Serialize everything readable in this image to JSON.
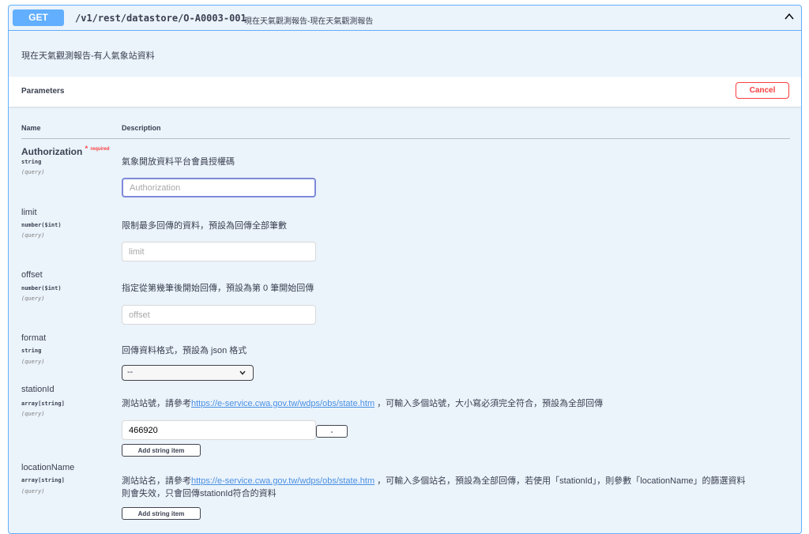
{
  "summary": {
    "method": "GET",
    "path": "/v1/rest/datastore/O-A0003-001",
    "description": "現在天氣觀測報告-現在天氣觀測報告",
    "toggle_icon": "chevron-up-icon"
  },
  "description": "現在天氣觀測報告-有人氣象站資料",
  "parameters_section": {
    "title": "Parameters",
    "cancel_label": "Cancel",
    "col_name": "Name",
    "col_description": "Description"
  },
  "params": {
    "authorization": {
      "name": "Authorization",
      "required_star": "*",
      "required_label": "required",
      "type": "string",
      "in": "(query)",
      "description": "氣象開放資料平台會員授權碼",
      "placeholder": "Authorization"
    },
    "limit": {
      "name": "limit",
      "type": "number($int)",
      "in": "(query)",
      "description": "限制最多回傳的資料，預設為回傳全部筆數",
      "placeholder": "limit"
    },
    "offset": {
      "name": "offset",
      "type": "number($int)",
      "in": "(query)",
      "description": "指定從第幾筆後開始回傳，預設為第 0 筆開始回傳",
      "placeholder": "offset"
    },
    "format": {
      "name": "format",
      "type": "string",
      "in": "(query)",
      "description": "回傳資料格式，預設為 json 格式",
      "selected": "--"
    },
    "stationId": {
      "name": "stationId",
      "type": "array[string]",
      "in": "(query)",
      "description_prefix": "測站站號，請參考",
      "link": "https://e-service.cwa.gov.tw/wdps/obs/state.htm",
      "description_suffix": " ，可輸入多個站號，大小寫必須完全符合，預設為全部回傳",
      "value": "466920",
      "remove_label": "-",
      "add_label": "Add string item"
    },
    "locationName": {
      "name": "locationName",
      "type": "array[string]",
      "in": "(query)",
      "description_prefix": "測站站名，請參考",
      "link": "https://e-service.cwa.gov.tw/wdps/obs/state.htm",
      "description_suffix": " ，可輸入多個站名，預設為全部回傳，若使用「stationId」，則參數「locationName」的篩選資料",
      "description_line2": "則會失效，只會回傳stationId符合的資料",
      "add_label": "Add string item"
    }
  },
  "colors": {
    "get_blue": "#61affe",
    "block_bg": "#ebf3fb",
    "cancel_red": "#f93e3e",
    "link_blue": "#4990e2"
  }
}
